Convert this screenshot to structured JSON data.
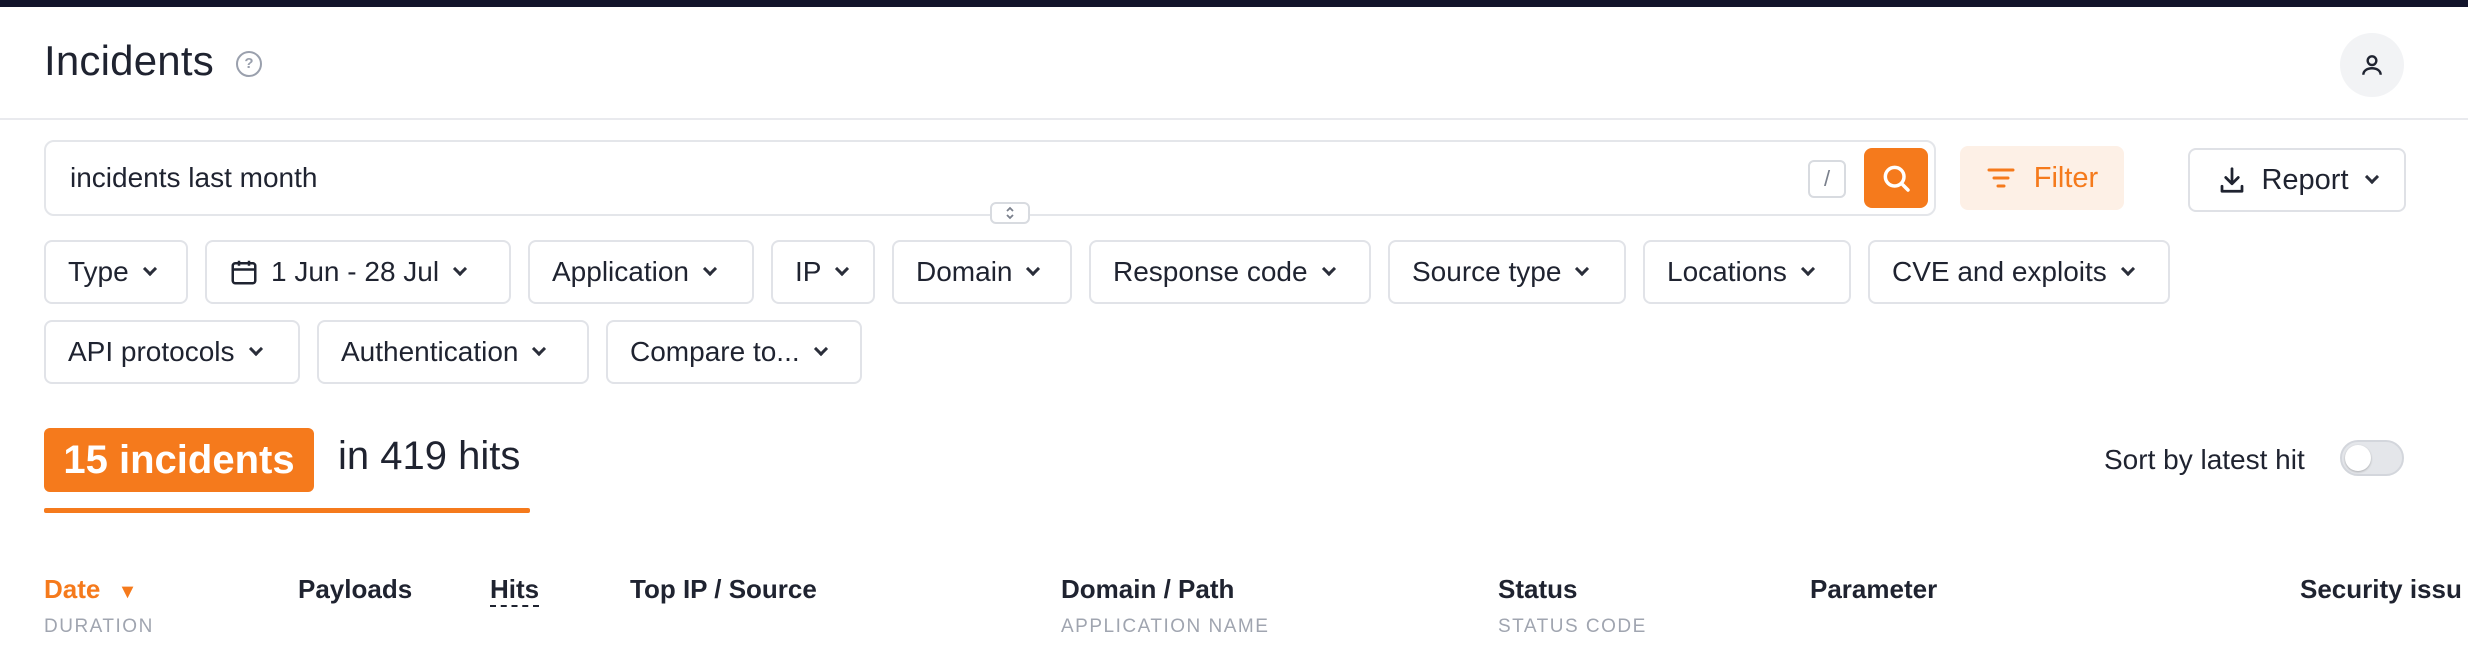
{
  "header": {
    "title": "Incidents"
  },
  "search": {
    "value": "incidents last month",
    "shortcut": "/"
  },
  "actions": {
    "filter_label": "Filter",
    "report_label": "Report"
  },
  "filters": [
    {
      "label": "Type"
    },
    {
      "label": "1 Jun - 28 Jul"
    },
    {
      "label": "Application"
    },
    {
      "label": "IP"
    },
    {
      "label": "Domain"
    },
    {
      "label": "Response code"
    },
    {
      "label": "Source type"
    },
    {
      "label": "Locations"
    },
    {
      "label": "CVE and exploits"
    },
    {
      "label": "API protocols"
    },
    {
      "label": "Authentication"
    },
    {
      "label": "Compare to..."
    }
  ],
  "summary": {
    "count_label": "15 incidents",
    "hits_label": "in 419 hits",
    "sort_label": "Sort by latest hit",
    "sort_enabled": false
  },
  "table": {
    "columns": [
      {
        "label": "Date",
        "sub": "DURATION"
      },
      {
        "label": "Payloads",
        "sub": ""
      },
      {
        "label": "Hits",
        "sub": ""
      },
      {
        "label": "Top IP / Source",
        "sub": ""
      },
      {
        "label": "Domain / Path",
        "sub": "APPLICATION NAME"
      },
      {
        "label": "Status",
        "sub": "STATUS CODE"
      },
      {
        "label": "Parameter",
        "sub": ""
      },
      {
        "label": "Security issu",
        "sub": ""
      }
    ]
  },
  "colors": {
    "accent": "#f57a1c",
    "topbar": "#12142b"
  }
}
